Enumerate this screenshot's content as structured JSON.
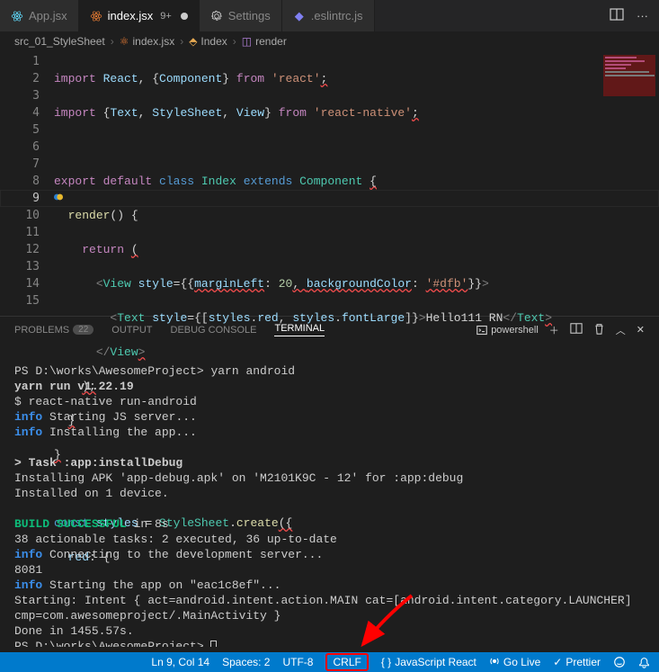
{
  "tabs": [
    {
      "label": "App.jsx",
      "icon": "react-icon",
      "active": false,
      "modified": false
    },
    {
      "label": "index.jsx",
      "icon": "react-icon-orange",
      "badge": "9+",
      "active": true,
      "modified": true
    },
    {
      "label": "Settings",
      "icon": "gear-icon",
      "active": false,
      "modified": false
    },
    {
      "label": ".eslintrc.js",
      "icon": "eslint-icon",
      "active": false,
      "modified": false
    }
  ],
  "breadcrumbs": {
    "c0": "src_01_StyleSheet",
    "c1": "index.jsx",
    "c2": "Index",
    "c3": "render"
  },
  "lines": {
    "l1": "1",
    "l2": "2",
    "l3": "3",
    "l4": "4",
    "l5": "5",
    "l6": "6",
    "l7": "7",
    "l8": "8",
    "l9": "9",
    "l10": "10",
    "l11": "11",
    "l12": "12",
    "l13": "13",
    "l14": "14",
    "l15": "15"
  },
  "code": {
    "l1": {
      "k1": "import",
      "v1": "React",
      "p1": ", {",
      "v2": "Component",
      "p2": "}",
      "k2": "from",
      "s1": "'react'",
      "p3": ";"
    },
    "l2": {
      "k1": "import",
      "p1": "{",
      "v1": "Text",
      "p2": ", ",
      "v2": "StyleSheet",
      "p3": ", ",
      "v3": "View",
      "p4": "}",
      "k2": "from",
      "s1": "'react-native'",
      "p5": ";"
    },
    "l4": {
      "k1": "export",
      "k2": "default",
      "k3": "class",
      "t1": "Index",
      "k4": "extends",
      "t2": "Component",
      "p1": "{"
    },
    "l5": {
      "y1": "render",
      "p1": "() {"
    },
    "l6": {
      "k1": "return",
      "p1": "("
    },
    "l7": {
      "b1": "<",
      "t1": "View",
      "a1": " style",
      "p1": "=",
      "p2": "{{",
      "a2": "marginLeft",
      "p3": ": ",
      "n1": "20",
      "p4": ", ",
      "a3": "backgroundColor",
      "p5": ": ",
      "s1": "'#dfb'",
      "p6": "}}",
      "b2": ">"
    },
    "l8": {
      "b1": "<",
      "t1": "Text",
      "a1": " style",
      "p1": "=",
      "p2": "{[",
      "v1": "styles",
      "p3": ".",
      "v2": "red",
      "p4": ", ",
      "v3": "styles",
      "p5": ".",
      "v4": "fontLarge",
      "p6": "]}",
      "b2": ">",
      "tx": "Hello111 RN",
      "b3": "</",
      "t2": "Text",
      "b4": ">"
    },
    "l9": {
      "b1": "</",
      "t1": "View",
      "b2": ">"
    },
    "l10": {
      "p1": ");"
    },
    "l11": {
      "p1": "}"
    },
    "l12": {
      "p1": "}"
    },
    "l14": {
      "k1": "const",
      "v1": "styles",
      "p1": " = ",
      "t1": "StyleSheet",
      "p2": ".",
      "y1": "create",
      "p3": "({"
    },
    "l15": {
      "v1": "red",
      "p1": ": {"
    }
  },
  "panel": {
    "problems": "PROBLEMS",
    "problems_count": "22",
    "output": "OUTPUT",
    "debug_console": "DEBUG CONSOLE",
    "terminal": "TERMINAL",
    "shell": "powershell"
  },
  "term": {
    "l1a": "PS D:\\works\\AwesomeProject> ",
    "l1b": "yarn ",
    "l1c": "android",
    "l2": "yarn run v1.22.19",
    "l3": "$ react-native run-android",
    "l4a": "info",
    "l4b": " Starting JS server...",
    "l5a": "info",
    "l5b": " Installing the app...",
    "l7a": "> ",
    "l7b": "Task :app:installDebug",
    "l8": "Installing APK 'app-debug.apk' on 'M2101K9C - 12' for :app:debug",
    "l9": "Installed on 1 device.",
    "l11a": "BUILD SUCCESSFUL",
    "l11b": " in 8s",
    "l12": "38 actionable tasks: 2 executed, 36 up-to-date",
    "l13a": "info",
    "l13b": " Connecting to the development server...",
    "l14": "8081",
    "l15a": "info",
    "l15b": " Starting the app on \"eac1c8ef\"...",
    "l16": "Starting: Intent { act=android.intent.action.MAIN cat=[android.intent.category.LAUNCHER] cmp=com.awesomeproject/.MainActivity }",
    "l17": "Done in 1455.57s.",
    "l18": "PS D:\\works\\AwesomeProject> "
  },
  "status": {
    "ln_col": "Ln 9, Col 14",
    "spaces": "Spaces: 2",
    "encoding": "UTF-8",
    "eol": "CRLF",
    "lang": "JavaScript React",
    "golive": "Go Live",
    "prettier": "Prettier"
  }
}
